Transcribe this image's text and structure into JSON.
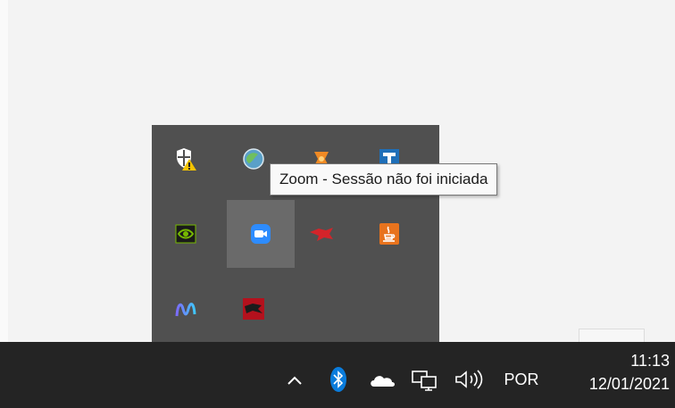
{
  "tooltip": {
    "text": "Zoom - Sessão não foi iniciada"
  },
  "tray_flyout": {
    "items": [
      {
        "icon": "windows-security-warning-icon"
      },
      {
        "icon": "globe-app-icon"
      },
      {
        "icon": "orange-app-icon"
      },
      {
        "icon": "blue-t-app-icon"
      },
      {
        "icon": "nvidia-icon"
      },
      {
        "icon": "zoom-icon"
      },
      {
        "icon": "red-app-icon"
      },
      {
        "icon": "java-update-icon"
      },
      {
        "icon": "wave-app-icon"
      },
      {
        "icon": "red-dark-app-icon"
      }
    ]
  },
  "taskbar": {
    "language": "POR",
    "time": "11:13",
    "date": "12/01/2021"
  }
}
